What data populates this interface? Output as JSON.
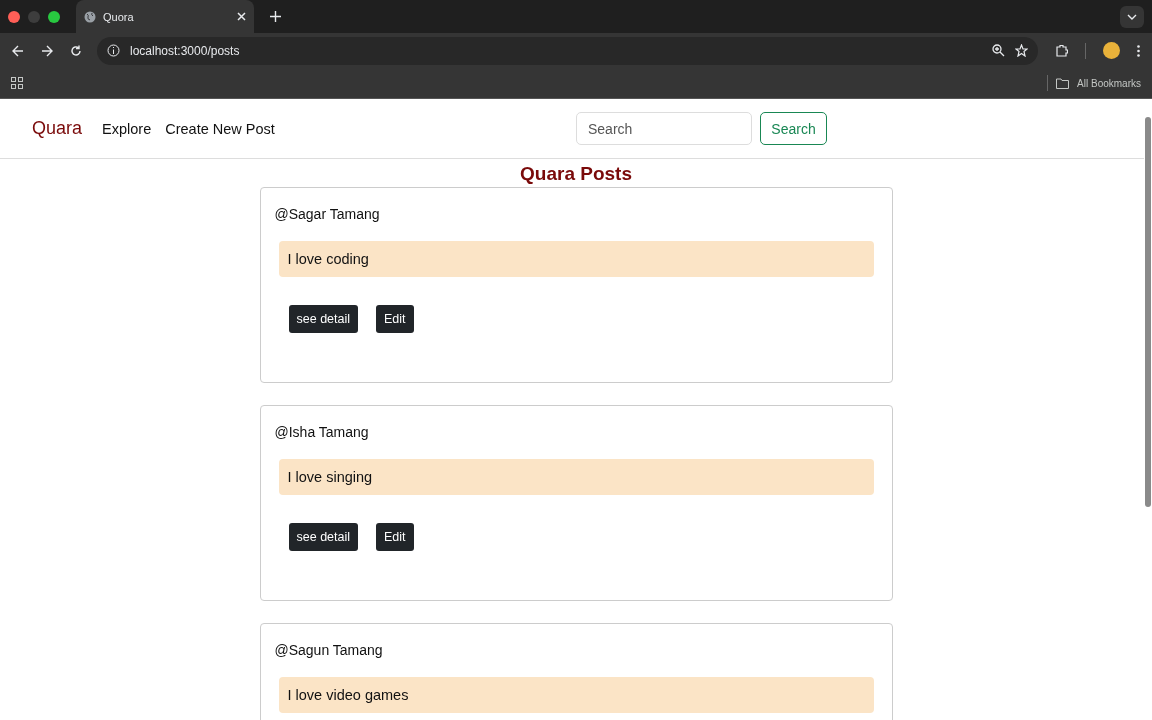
{
  "browser": {
    "tab_title": "Quora",
    "url": "localhost:3000/posts",
    "bookmarks_label": "All Bookmarks"
  },
  "navbar": {
    "brand": "Quara",
    "links": [
      "Explore",
      "Create New Post"
    ],
    "search": {
      "placeholder": "Search",
      "button": "Search"
    }
  },
  "page_title": "Quara Posts",
  "posts": [
    {
      "author": "@Sagar Tamang",
      "content": "I love coding",
      "buttons": [
        "see detail",
        "Edit"
      ]
    },
    {
      "author": "@Isha Tamang",
      "content": "I love singing",
      "buttons": [
        "see detail",
        "Edit"
      ]
    },
    {
      "author": "@Sagun Tamang",
      "content": "I love video games"
    }
  ]
}
